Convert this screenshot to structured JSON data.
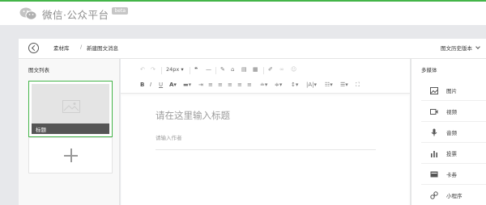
{
  "header": {
    "logo_text": "微信·公众平台",
    "badge": "beta"
  },
  "breadcrumb": {
    "library": "素材库",
    "separator": "/",
    "current": "新建图文消息",
    "history": "图文历史版本"
  },
  "left_panel": {
    "title": "图文列表",
    "article_title": "标题"
  },
  "editor": {
    "font_size": "24px",
    "title_placeholder": "请在这里输入标题",
    "author_placeholder": "请输入作者"
  },
  "right_panel": {
    "title": "多媒体",
    "items": [
      {
        "label": "图片",
        "icon": "image-icon"
      },
      {
        "label": "视频",
        "icon": "video-icon"
      },
      {
        "label": "音频",
        "icon": "microphone-icon"
      },
      {
        "label": "投票",
        "icon": "poll-icon"
      },
      {
        "label": "卡券",
        "icon": "card-icon"
      },
      {
        "label": "小程序",
        "icon": "mini-program-icon"
      }
    ]
  },
  "colors": {
    "accent": "#44b549",
    "background": "#e7e8eb"
  }
}
